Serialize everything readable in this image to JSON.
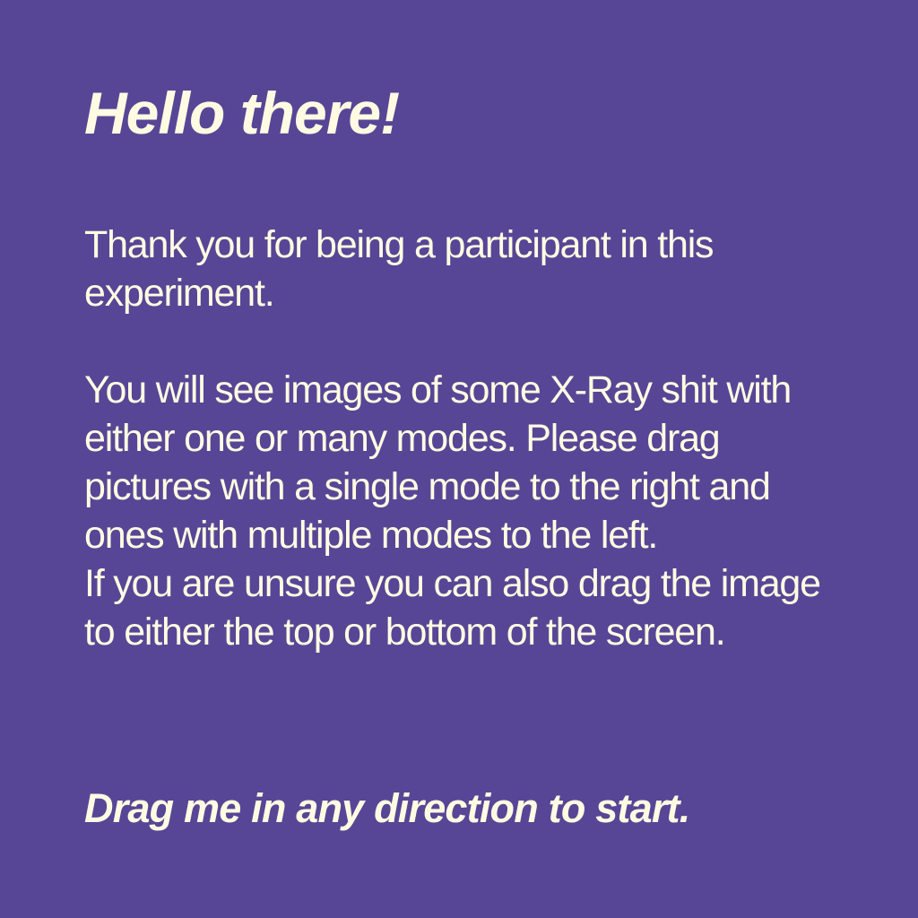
{
  "card": {
    "background_color": "#574696",
    "text_color": "#fffbe2",
    "title": "Hello there!",
    "paragraph_1": "Thank you for being a participant in this experiment.",
    "paragraph_2": "You will see images of some X-Ray shit with either one or many modes. Please drag pictures with a single mode to the right and ones with multiple modes to the left.",
    "paragraph_3": "If you are unsure you can also drag the image to either the top or bottom of the screen.",
    "call_to_action": "Drag me in any direction to start."
  }
}
